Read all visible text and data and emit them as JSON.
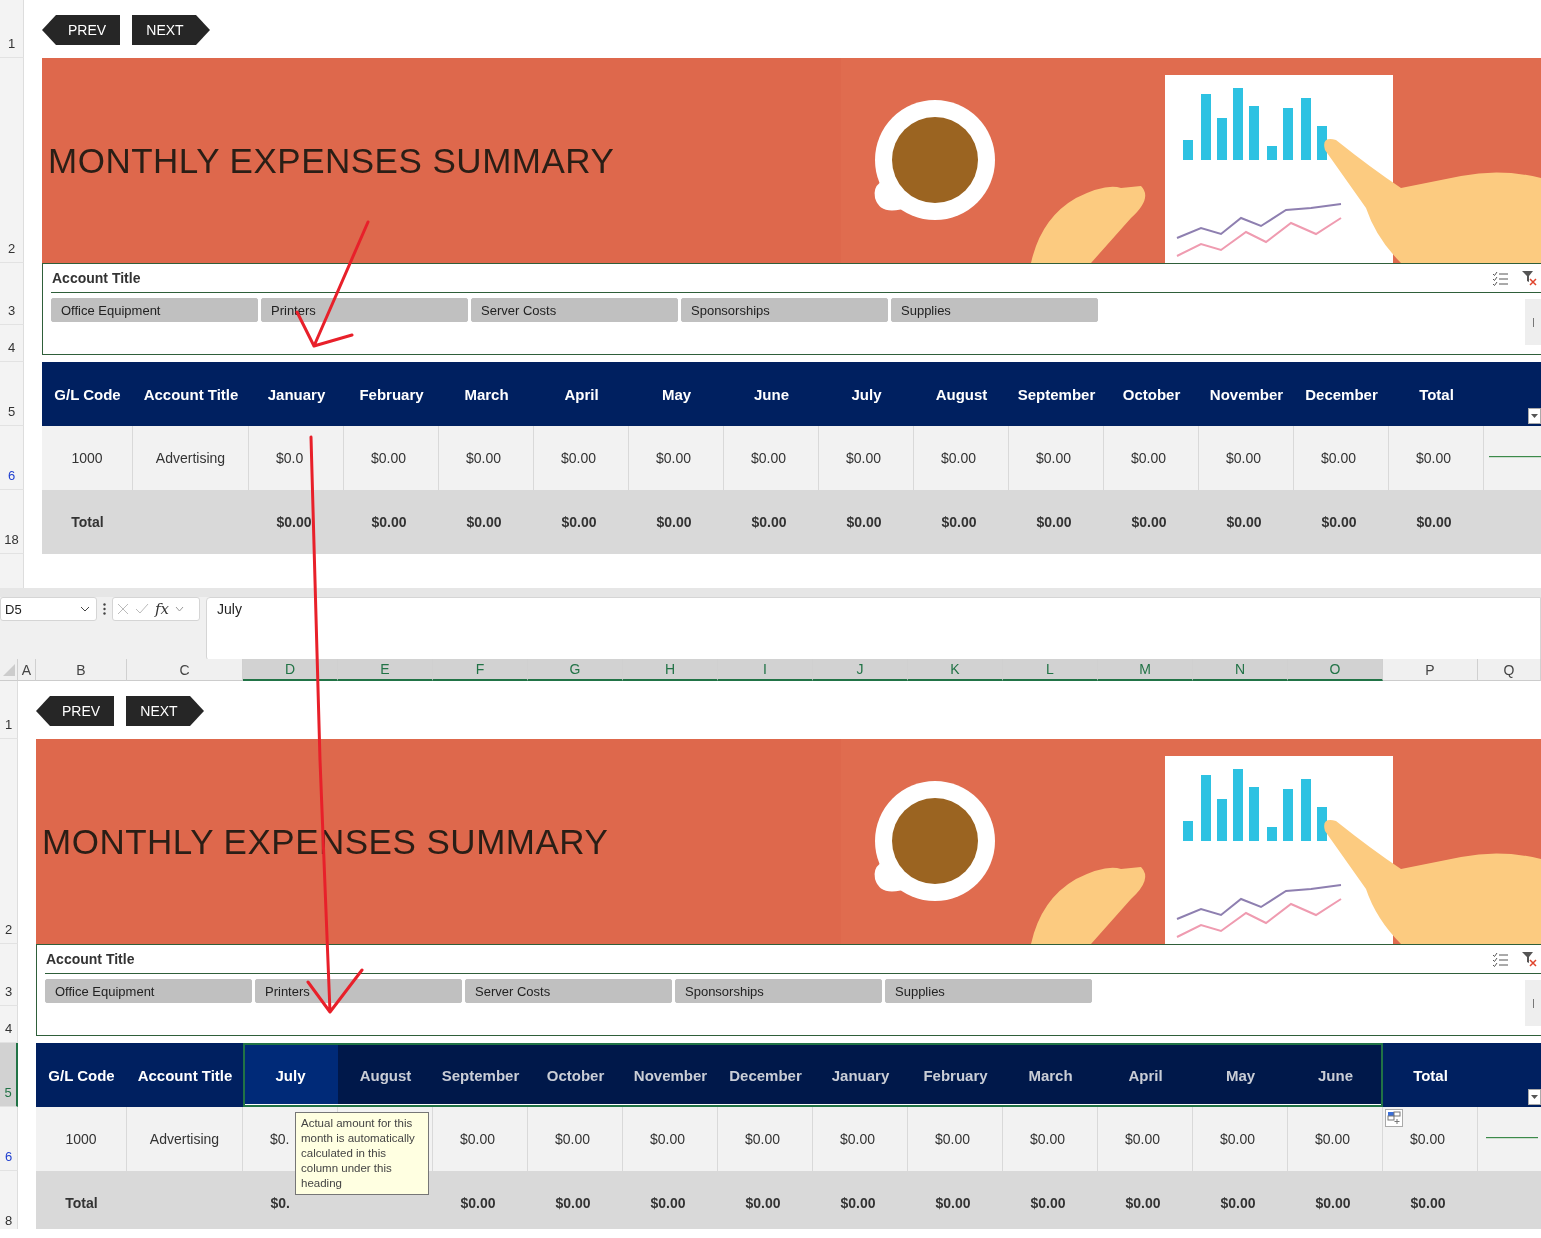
{
  "top_sheet": {
    "nav": [
      {
        "label": "PREV",
        "kind": "prev"
      },
      {
        "label": "NEXT",
        "kind": "next"
      }
    ],
    "row_numbers": [
      {
        "label": "1",
        "selected": false,
        "filtered": false
      },
      {
        "label": "2",
        "selected": false,
        "filtered": false
      },
      {
        "label": "3",
        "selected": false,
        "filtered": false
      },
      {
        "label": "4",
        "selected": false,
        "filtered": false
      },
      {
        "label": "5",
        "selected": false,
        "filtered": false
      },
      {
        "label": "6",
        "selected": false,
        "filtered": true
      },
      {
        "label": "18",
        "selected": false,
        "filtered": false
      }
    ],
    "banner": {
      "title": "MONTHLY EXPENSES SUMMARY"
    },
    "slicer": {
      "title": "Account Title",
      "items": [
        {
          "label": "Office Equipment",
          "selected": true
        },
        {
          "label": "Printers",
          "selected": true
        },
        {
          "label": "Server Costs",
          "selected": true
        },
        {
          "label": "Sponsorships",
          "selected": true
        },
        {
          "label": "Supplies",
          "selected": true
        }
      ]
    },
    "table": {
      "columns": [
        {
          "label": "G/L Code",
          "selected": false
        },
        {
          "label": "Account Title",
          "selected": false
        },
        {
          "label": "January",
          "selected": false
        },
        {
          "label": "February",
          "selected": false
        },
        {
          "label": "March",
          "selected": false
        },
        {
          "label": "April",
          "selected": false
        },
        {
          "label": "May",
          "selected": false
        },
        {
          "label": "June",
          "selected": false
        },
        {
          "label": "July",
          "selected": false
        },
        {
          "label": "August",
          "selected": false
        },
        {
          "label": "September",
          "selected": false
        },
        {
          "label": "October",
          "selected": false
        },
        {
          "label": "November",
          "selected": false
        },
        {
          "label": "December",
          "selected": false
        },
        {
          "label": "Total",
          "selected": false
        }
      ],
      "rows": [
        {
          "kind": "data",
          "cells": [
            "1000",
            "Advertising",
            "$0.0",
            "$0.00",
            "$0.00",
            "$0.00",
            "$0.00",
            "$0.00",
            "$0.00",
            "$0.00",
            "$0.00",
            "$0.00",
            "$0.00",
            "$0.00",
            "$0.00"
          ]
        },
        {
          "kind": "total",
          "cells": [
            "Total",
            null,
            "$0.00",
            "$0.00",
            "$0.00",
            "$0.00",
            "$0.00",
            "$0.00",
            "$0.00",
            "$0.00",
            "$0.00",
            "$0.00",
            "$0.00",
            "$0.00",
            "$0.00"
          ]
        }
      ]
    }
  },
  "formula_bar": {
    "name_box": "D5",
    "function_label": "fx",
    "formula": "July"
  },
  "column_headers": [
    {
      "label": "A",
      "selected": false
    },
    {
      "label": "B",
      "selected": false
    },
    {
      "label": "C",
      "selected": false
    },
    {
      "label": "D",
      "selected": true
    },
    {
      "label": "E",
      "selected": true
    },
    {
      "label": "F",
      "selected": true
    },
    {
      "label": "G",
      "selected": true
    },
    {
      "label": "H",
      "selected": true
    },
    {
      "label": "I",
      "selected": true
    },
    {
      "label": "J",
      "selected": true
    },
    {
      "label": "K",
      "selected": true
    },
    {
      "label": "L",
      "selected": true
    },
    {
      "label": "M",
      "selected": true
    },
    {
      "label": "N",
      "selected": true
    },
    {
      "label": "O",
      "selected": true
    },
    {
      "label": "P",
      "selected": false
    },
    {
      "label": "Q",
      "selected": false
    }
  ],
  "bottom_sheet": {
    "nav": [
      {
        "label": "PREV",
        "kind": "prev"
      },
      {
        "label": "NEXT",
        "kind": "next"
      }
    ],
    "row_numbers": [
      {
        "label": "1",
        "selected": false,
        "filtered": false
      },
      {
        "label": "2",
        "selected": false,
        "filtered": false
      },
      {
        "label": "3",
        "selected": false,
        "filtered": false
      },
      {
        "label": "4",
        "selected": false,
        "filtered": false
      },
      {
        "label": "5",
        "selected": true,
        "filtered": false
      },
      {
        "label": "6",
        "selected": false,
        "filtered": true
      },
      {
        "label": "8",
        "selected": false,
        "filtered": false
      }
    ],
    "banner": {
      "title": "MONTHLY EXPENSES SUMMARY"
    },
    "slicer": {
      "title": "Account Title",
      "items": [
        {
          "label": "Office Equipment",
          "selected": true
        },
        {
          "label": "Printers",
          "selected": true
        },
        {
          "label": "Server Costs",
          "selected": true
        },
        {
          "label": "Sponsorships",
          "selected": true
        },
        {
          "label": "Supplies",
          "selected": true
        }
      ]
    },
    "table": {
      "columns": [
        {
          "label": "G/L Code",
          "selected": false,
          "active": false
        },
        {
          "label": "Account Title",
          "selected": false,
          "active": false
        },
        {
          "label": "July",
          "selected": true,
          "active": true
        },
        {
          "label": "August",
          "selected": true,
          "active": false
        },
        {
          "label": "September",
          "selected": true,
          "active": false
        },
        {
          "label": "October",
          "selected": true,
          "active": false
        },
        {
          "label": "November",
          "selected": true,
          "active": false
        },
        {
          "label": "December",
          "selected": true,
          "active": false
        },
        {
          "label": "January",
          "selected": true,
          "active": false
        },
        {
          "label": "February",
          "selected": true,
          "active": false
        },
        {
          "label": "March",
          "selected": true,
          "active": false
        },
        {
          "label": "April",
          "selected": true,
          "active": false
        },
        {
          "label": "May",
          "selected": true,
          "active": false
        },
        {
          "label": "June",
          "selected": true,
          "active": false
        },
        {
          "label": "Total",
          "selected": false,
          "active": false
        }
      ],
      "rows": [
        {
          "kind": "data",
          "cells": [
            "1000",
            "Advertising",
            "$0.",
            null,
            "$0.00",
            "$0.00",
            "$0.00",
            "$0.00",
            "$0.00",
            "$0.00",
            "$0.00",
            "$0.00",
            "$0.00",
            "$0.00",
            "$0.00"
          ]
        },
        {
          "kind": "total",
          "cells": [
            "Total",
            null,
            "$0.",
            null,
            "$0.00",
            "$0.00",
            "$0.00",
            "$0.00",
            "$0.00",
            "$0.00",
            "$0.00",
            "$0.00",
            "$0.00",
            "$0.00",
            "$0.00"
          ]
        }
      ]
    },
    "tooltip": "Actual amount for this month is automatically calculated in this column under this heading"
  }
}
